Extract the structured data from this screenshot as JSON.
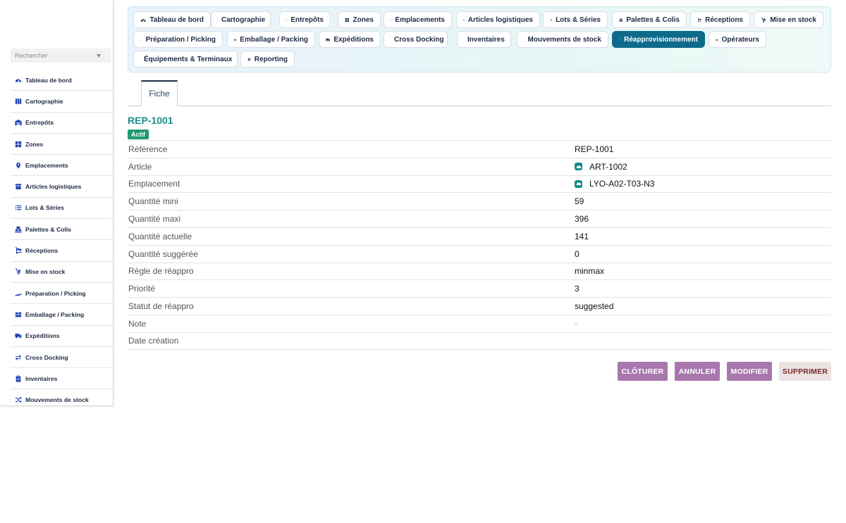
{
  "sidebar": {
    "search_placeholder": "Rechercher",
    "items": [
      {
        "label": "Tableau de bord",
        "icon": "dashboard-icon"
      },
      {
        "label": "Cartographie",
        "icon": "map-icon"
      },
      {
        "label": "Entrepôts",
        "icon": "warehouse-icon"
      },
      {
        "label": "Zones",
        "icon": "grid-icon"
      },
      {
        "label": "Emplacements",
        "icon": "pin-icon"
      },
      {
        "label": "Articles logistiques",
        "icon": "box-icon"
      },
      {
        "label": "Lots & Séries",
        "icon": "list-icon"
      },
      {
        "label": "Palettes & Colis",
        "icon": "pallet-icon"
      },
      {
        "label": "Réceptions",
        "icon": "dolly-icon"
      },
      {
        "label": "Mise en stock",
        "icon": "putaway-icon"
      },
      {
        "label": "Préparation / Picking",
        "icon": "hand-icon"
      },
      {
        "label": "Emballage / Packing",
        "icon": "boxes-icon"
      },
      {
        "label": "Expéditions",
        "icon": "truck-icon"
      },
      {
        "label": "Cross Docking",
        "icon": "arrows-icon"
      },
      {
        "label": "Inventaires",
        "icon": "clipboard-icon"
      },
      {
        "label": "Mouvements de stock",
        "icon": "shuffle-icon"
      }
    ]
  },
  "topnav": {
    "items": [
      {
        "label": "Tableau de bord",
        "icon": "dashboard-icon"
      },
      {
        "label": "Cartographie",
        "icon": "map-icon"
      },
      {
        "label": "Entrepôts",
        "icon": "warehouse-icon"
      },
      {
        "label": "Zones",
        "icon": "grid-icon"
      },
      {
        "label": "Emplacements",
        "icon": "pin-icon"
      },
      {
        "label": "Articles logistiques",
        "icon": "box-icon"
      },
      {
        "label": "Lots & Séries",
        "icon": "list-icon"
      },
      {
        "label": "Palettes & Colis",
        "icon": "pallet-icon"
      },
      {
        "label": "Réceptions",
        "icon": "dolly-icon"
      },
      {
        "label": "Mise en stock",
        "icon": "putaway-icon"
      },
      {
        "label": "Préparation / Picking",
        "icon": "hand-icon"
      },
      {
        "label": "Emballage / Packing",
        "icon": "boxes-icon"
      },
      {
        "label": "Expéditions",
        "icon": "truck-icon"
      },
      {
        "label": "Cross Docking",
        "icon": "arrows-icon"
      },
      {
        "label": "Inventaires",
        "icon": "clipboard-icon"
      },
      {
        "label": "Mouvements de stock",
        "icon": "shuffle-icon"
      },
      {
        "label": "Réapprovisionnement",
        "icon": "refresh-icon",
        "active": true
      },
      {
        "label": "Opérateurs",
        "icon": "operator-icon"
      },
      {
        "label": "Équipements & Terminaux",
        "icon": "phone-icon"
      },
      {
        "label": "Reporting",
        "icon": "pie-icon"
      }
    ]
  },
  "tabs": {
    "fiche": "Fiche"
  },
  "record": {
    "title": "REP-1001",
    "status": "Actif",
    "fields": [
      {
        "key": "Référence",
        "value": "REP-1001"
      },
      {
        "key": "Article",
        "value": "ART-1002",
        "link": true
      },
      {
        "key": "Emplacement",
        "value": "LYO-A02-T03-N3",
        "link": true
      },
      {
        "key": "Quantité mini",
        "value": "59"
      },
      {
        "key": "Quantité maxi",
        "value": "396"
      },
      {
        "key": "Quantité actuelle",
        "value": "141"
      },
      {
        "key": "Quantité suggérée",
        "value": "0"
      },
      {
        "key": "Règle de réappro",
        "value": "minmax"
      },
      {
        "key": "Priorité",
        "value": "3"
      },
      {
        "key": "Statut de réappro",
        "value": "suggested"
      },
      {
        "key": "Note",
        "value": "-",
        "muted": true
      },
      {
        "key": "Date création",
        "value": ""
      }
    ]
  },
  "actions": {
    "cloturer": "CLÔTURER",
    "annuler": "ANNULER",
    "modifier": "MODIFIER",
    "supprimer": "SUPPRIMER"
  },
  "colors": {
    "accent": "#0d6a8a",
    "title": "#1a8c8c",
    "badge": "#1f9b6e",
    "action": "#a877ae",
    "icon": "#1e40af"
  }
}
